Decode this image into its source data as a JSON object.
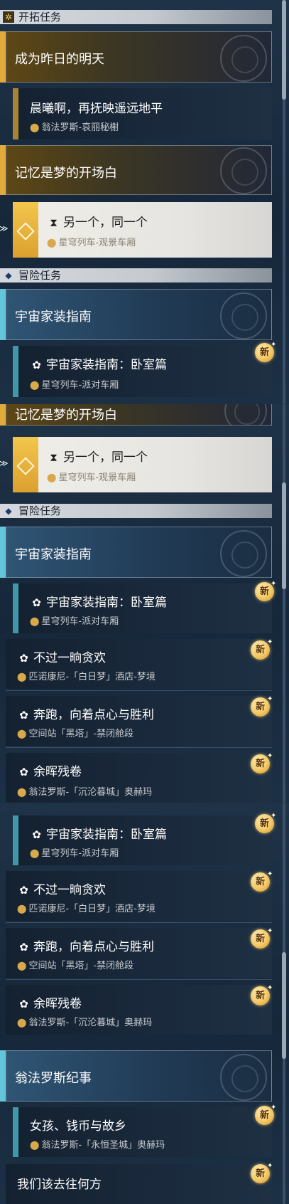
{
  "new_badge": "新",
  "s1": {
    "section_main": "开拓任务",
    "cat1": "成为昨日的明天",
    "task1": {
      "title": "晨曦啊，再抚映遥远地平",
      "loc": "翁法罗斯-哀丽秘榭"
    },
    "cat2": "记忆是梦的开场白",
    "task_sel": {
      "title": "另一个，同一个",
      "loc": "星穹列车-观景车厢"
    },
    "section_adv": "冒险任务",
    "cat3": "宇宙家装指南",
    "task2": {
      "title": "宇宙家装指南：卧室篇",
      "loc": "星穹列车-派对车厢"
    }
  },
  "s2": {
    "cat_partial": "记忆是梦的开场白",
    "task_sel": {
      "title": "另一个，同一个",
      "loc": "星穹列车-观景车厢"
    },
    "section_adv": "冒险任务",
    "cat3": "宇宙家装指南",
    "task2": {
      "title": "宇宙家装指南：卧室篇",
      "loc": "星穹列车-派对车厢"
    },
    "task3": {
      "title": "不过一晌贪欢",
      "loc": "匹诺康尼-「白日梦」酒店-梦境"
    },
    "task4": {
      "title": "奔跑，向着点心与胜利",
      "loc": "空间站「黑塔」-禁闭舱段"
    },
    "task5": {
      "title": "余晖残卷",
      "loc": "翁法罗斯-「沉沦暮城」奥赫玛"
    }
  },
  "s3": {
    "task2": {
      "title": "宇宙家装指南：卧室篇",
      "loc": "星穹列车-派对车厢"
    },
    "task3": {
      "title": "不过一晌贪欢",
      "loc": "匹诺康尼-「白日梦」酒店-梦境"
    },
    "task4": {
      "title": "奔跑，向着点心与胜利",
      "loc": "空间站「黑塔」-禁闭舱段"
    },
    "task5": {
      "title": "余晖残卷",
      "loc": "翁法罗斯-「沉沦暮城」奥赫玛"
    },
    "cat4": "翁法罗斯纪事",
    "task6": {
      "title": "女孩、钱币与故乡",
      "loc": "翁法罗斯-「永恒圣城」奥赫玛"
    },
    "task7": {
      "title": "我们该去往何方"
    }
  }
}
